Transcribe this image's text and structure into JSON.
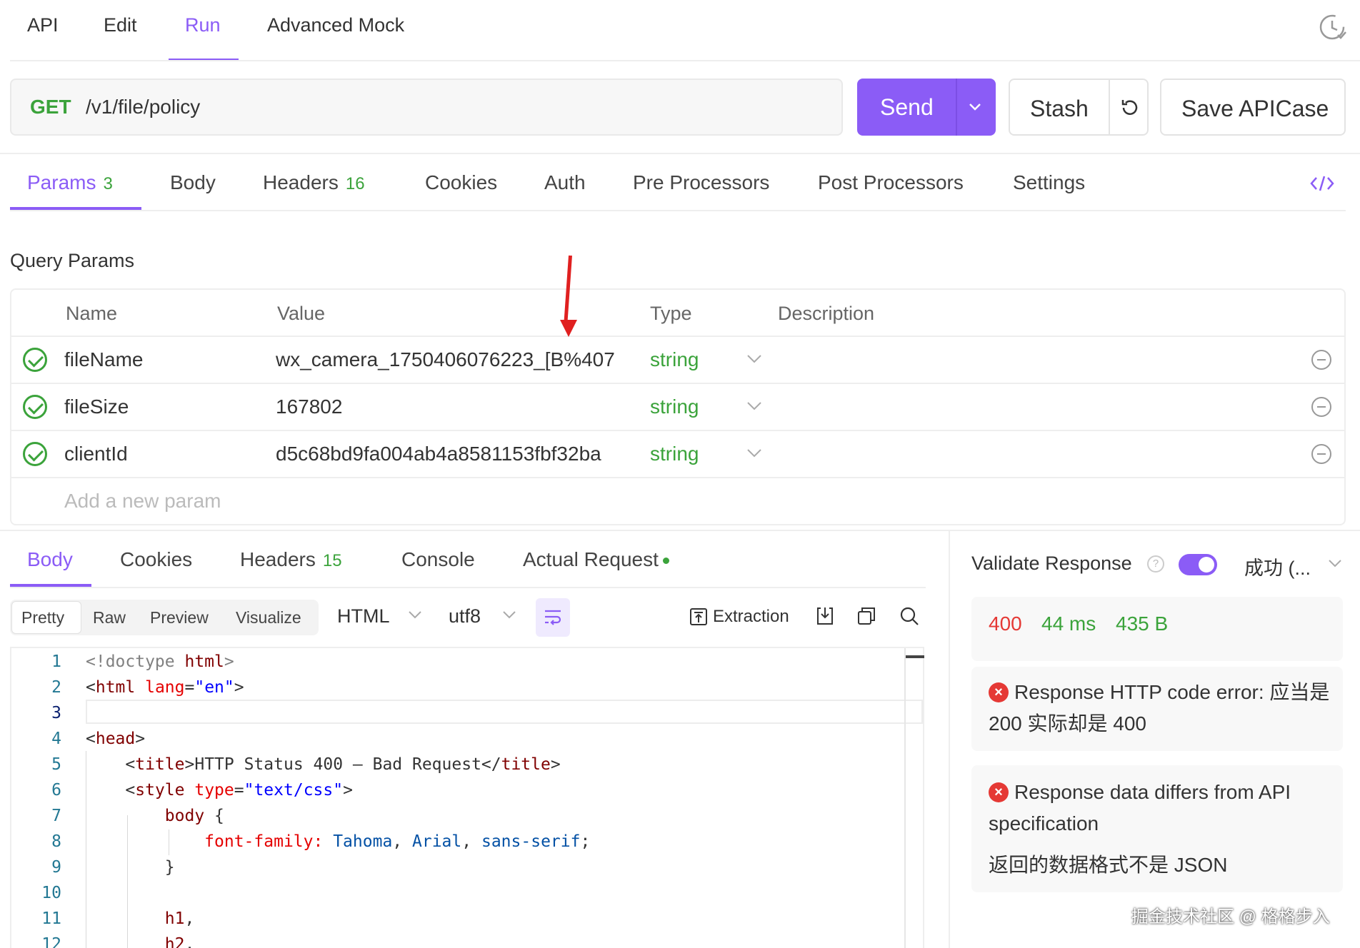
{
  "top_tabs": [
    "API",
    "Edit",
    "Run",
    "Advanced Mock"
  ],
  "request": {
    "method": "GET",
    "url": "/v1/file/policy",
    "send_label": "Send",
    "stash_label": "Stash",
    "save_label": "Save APICase"
  },
  "sub_tabs": {
    "params": "Params",
    "params_count": "3",
    "body": "Body",
    "headers": "Headers",
    "headers_count": "16",
    "cookies": "Cookies",
    "auth": "Auth",
    "pre": "Pre Processors",
    "post": "Post Processors",
    "settings": "Settings"
  },
  "query_params": {
    "title": "Query Params",
    "columns": [
      "Name",
      "Value",
      "Type",
      "Description"
    ],
    "rows": [
      {
        "name": "fileName",
        "value": "wx_camera_1750406076223_[B%407",
        "type": "string"
      },
      {
        "name": "fileSize",
        "value": "167802",
        "type": "string"
      },
      {
        "name": "clientId",
        "value": "d5c68bd9fa004ab4a8581153fbf32ba",
        "type": "string"
      }
    ],
    "add_placeholder": "Add a new param"
  },
  "response_tabs": {
    "body": "Body",
    "cookies": "Cookies",
    "headers": "Headers",
    "headers_count": "15",
    "console": "Console",
    "actual": "Actual Request"
  },
  "view_modes": [
    "Pretty",
    "Raw",
    "Preview",
    "Visualize"
  ],
  "format": "HTML",
  "encoding": "utf8",
  "extraction_label": "Extraction",
  "code_line_numbers": [
    "1",
    "2",
    "3",
    "4",
    "5",
    "6",
    "7",
    "8",
    "9",
    "10",
    "11",
    "12"
  ],
  "validate": {
    "label": "Validate Response",
    "status": "成功 (...",
    "code": "400",
    "time": "44 ms",
    "size": "435 B",
    "error1": "Response HTTP code error: 应当是 200 实际却是 400",
    "error2_title": "Response data differs from API specification",
    "error2_detail": "返回的数据格式不是 JSON"
  },
  "colors": {
    "accent": "#8B5CF6",
    "success": "#3BA33B",
    "error": "#E53935"
  },
  "icons": [
    "history-icon",
    "chevron-down-icon",
    "refresh-icon",
    "code-icon",
    "check-circle-icon",
    "minus-circle-icon",
    "wrap-lines-icon",
    "extraction-icon",
    "download-icon",
    "copy-icon",
    "search-icon",
    "help-icon",
    "error-icon",
    "red-arrow-annotation"
  ],
  "watermark": "掘金技术社区 @ 格格步入"
}
